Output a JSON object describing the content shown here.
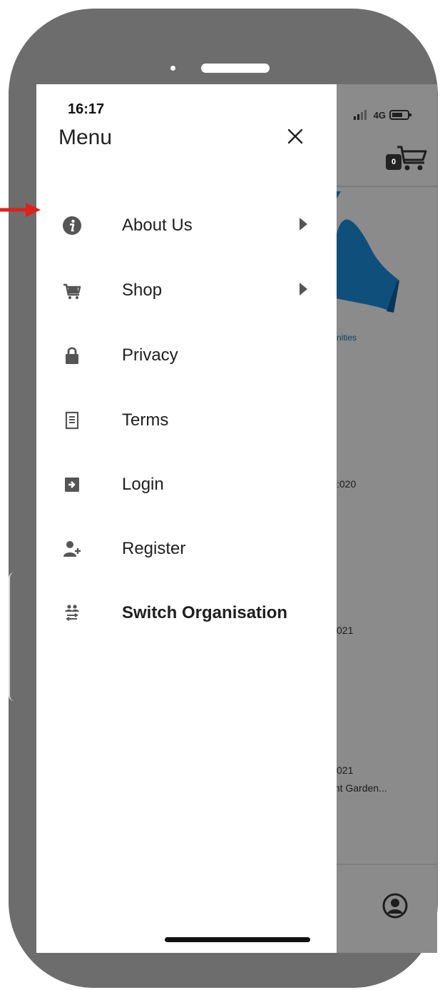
{
  "status_bar": {
    "time": "16:17",
    "network": "4G"
  },
  "drawer": {
    "title": "Menu",
    "items": [
      {
        "label": "About Us",
        "icon": "info-circle-icon",
        "has_submenu": true,
        "bold": false
      },
      {
        "label": "Shop",
        "icon": "cart-icon",
        "has_submenu": true,
        "bold": false
      },
      {
        "label": "Privacy",
        "icon": "lock-icon",
        "has_submenu": false,
        "bold": false
      },
      {
        "label": "Terms",
        "icon": "document-icon",
        "has_submenu": false,
        "bold": false
      },
      {
        "label": "Login",
        "icon": "login-icon",
        "has_submenu": false,
        "bold": false
      },
      {
        "label": "Register",
        "icon": "add-user-icon",
        "has_submenu": false,
        "bold": false
      },
      {
        "label": "Switch Organisation",
        "icon": "switch-people-icon",
        "has_submenu": false,
        "bold": true
      }
    ]
  },
  "background": {
    "cart_count": "0",
    "hero_caption": "nities",
    "event_1": ":020",
    "event_2": "021",
    "event_3_date": "021",
    "event_3_title": "ent Garden..."
  },
  "colors": {
    "accent": "#0e4d79",
    "annotation": "#e0201b"
  }
}
